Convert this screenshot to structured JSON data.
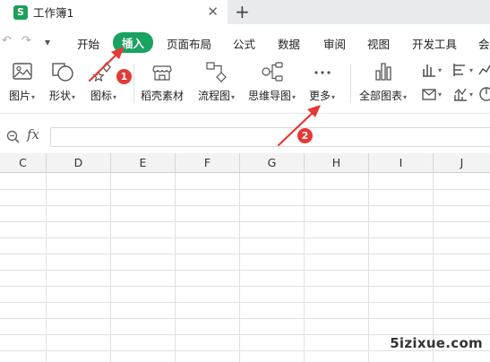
{
  "window": {
    "tab_title": "工作簿1",
    "app_logo_letter": "S",
    "close_glyph": "✕",
    "new_tab_glyph": "+"
  },
  "quick_access": {
    "undo_glyph": "↶",
    "redo_glyph": "↷",
    "more_glyph": "▾"
  },
  "menu": {
    "items": [
      "开始",
      "插入",
      "页面布局",
      "公式",
      "数据",
      "审阅",
      "视图",
      "开发工具",
      "会"
    ],
    "active": "插入"
  },
  "toolbar": {
    "picture_label": "图片",
    "shape_label": "形状",
    "icon_label": "图标",
    "template_label": "稻壳素材",
    "flowchart_label": "流程图",
    "mindmap_label": "思维导图",
    "more_label": "更多",
    "allcharts_label": "全部图表",
    "dropdown_glyph": "▾"
  },
  "formula_bar": {
    "fx_label": "fx",
    "value": ""
  },
  "sheet": {
    "columns": [
      "C",
      "D",
      "E",
      "F",
      "G",
      "H",
      "I",
      "J"
    ]
  },
  "annotations": {
    "badge_1": "1",
    "badge_2": "2",
    "accent_color": "#e53935"
  },
  "watermark": "5izixue.com",
  "colors": {
    "active_tab": "#1aa260",
    "app_logo": "#1d9e5b"
  }
}
